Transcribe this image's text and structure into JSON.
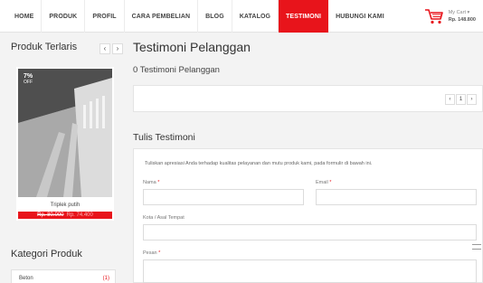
{
  "nav": {
    "items": [
      {
        "label": "HOME",
        "active": false
      },
      {
        "label": "PRODUK",
        "active": false
      },
      {
        "label": "PROFIL",
        "active": false
      },
      {
        "label": "CARA PEMBELIAN",
        "active": false
      },
      {
        "label": "BLOG",
        "active": false
      },
      {
        "label": "KATALOG",
        "active": false
      },
      {
        "label": "TESTIMONI",
        "active": true
      },
      {
        "label": "HUBUNGI KAMI",
        "active": false
      }
    ],
    "cart": {
      "label": "My Cart ▾",
      "amount": "Rp. 148.800",
      "icon": "shopping-cart-icon"
    }
  },
  "sidebar": {
    "title": "Produk Terlaris",
    "prev_arrow": "‹",
    "next_arrow": "›",
    "product": {
      "badge_percent": "7%",
      "badge_text": "OFF",
      "name": "Triplek putih",
      "price_old": "Rp. 80.000",
      "price_new": "Rp. 74.400"
    },
    "categories_title": "Kategori Produk",
    "categories": [
      {
        "name": "Beton",
        "count": "(1)"
      }
    ]
  },
  "main": {
    "title": "Testimoni Pelanggan",
    "count_text": "0 Testimoni Pelanggan",
    "pager": {
      "prev": "‹",
      "page": "1",
      "next": "›"
    },
    "form": {
      "title": "Tulis Testimoni",
      "intro": "Tuliskan apresiasi Anda terhadap kualitas pelayanan dan mutu produk kami, pada formulir di bawah ini.",
      "name_label": "Nama",
      "email_label": "Email",
      "city_label": "Kota / Asal Tempat",
      "message_label": "Pesan",
      "required_mark": "*",
      "name_value": "",
      "email_value": "",
      "city_value": "",
      "message_value": ""
    }
  },
  "colors": {
    "accent": "#e8141b",
    "background": "#f3f3f3"
  }
}
